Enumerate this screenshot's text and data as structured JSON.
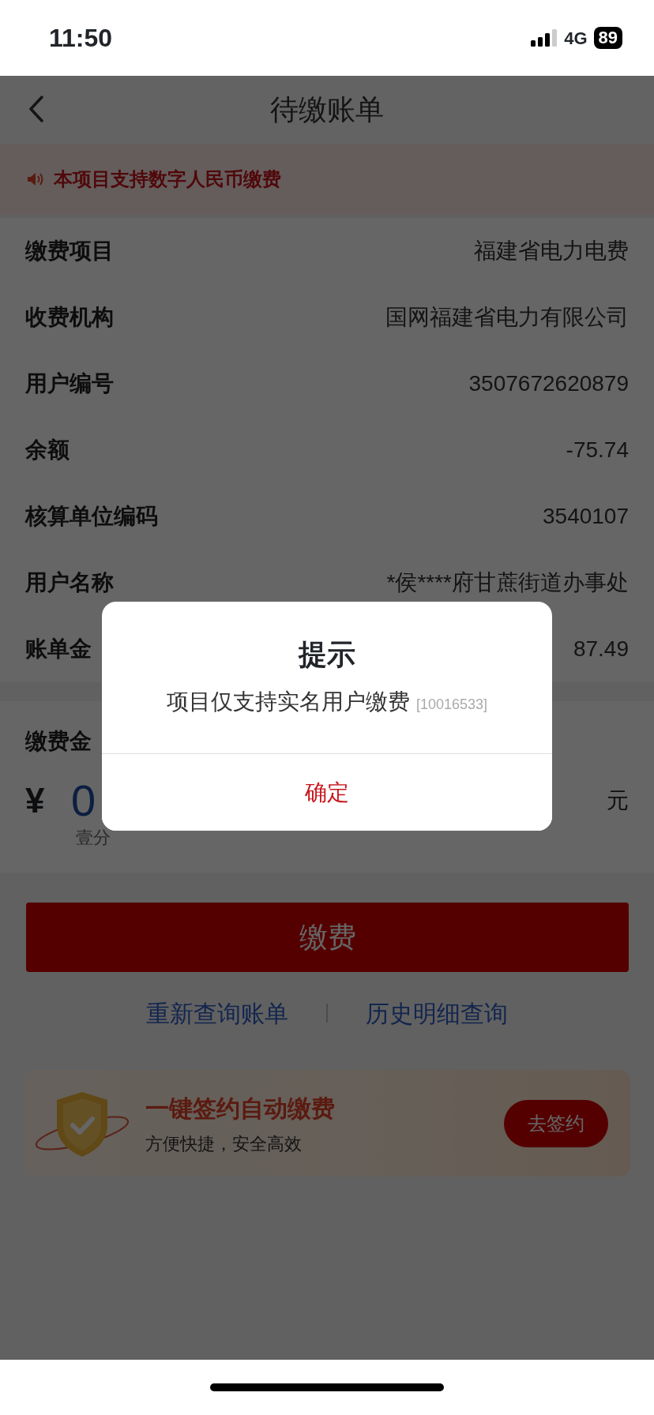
{
  "status_bar": {
    "time": "11:50",
    "network": "4G",
    "battery": "89"
  },
  "nav": {
    "title": "待缴账单"
  },
  "notice": {
    "text": "本项目支持数字人民币缴费"
  },
  "details": [
    {
      "label": "缴费项目",
      "value": "福建省电力电费"
    },
    {
      "label": "收费机构",
      "value": "国网福建省电力有限公司"
    },
    {
      "label": "用户编号",
      "value": "3507672620879"
    },
    {
      "label": "余额",
      "value": "-75.74"
    },
    {
      "label": "核算单位编码",
      "value": "3540107"
    },
    {
      "label": "用户名称",
      "value": "*侯****府甘蔗街道办事处"
    },
    {
      "label": "账单金",
      "value": "87.49"
    }
  ],
  "payment": {
    "label": "缴费金",
    "currency": "¥",
    "amount": "0",
    "unit": "元",
    "amount_words": "壹分"
  },
  "pay_button": "缴费",
  "links": [
    "重新查询账单",
    "历史明细查询"
  ],
  "banner": {
    "title": "一键签约自动缴费",
    "subtitle": "方便快捷，安全高效",
    "button": "去签约"
  },
  "dialog": {
    "title": "提示",
    "message": "项目仅支持实名用户缴费",
    "code": "[10016533]",
    "button": "确定"
  }
}
